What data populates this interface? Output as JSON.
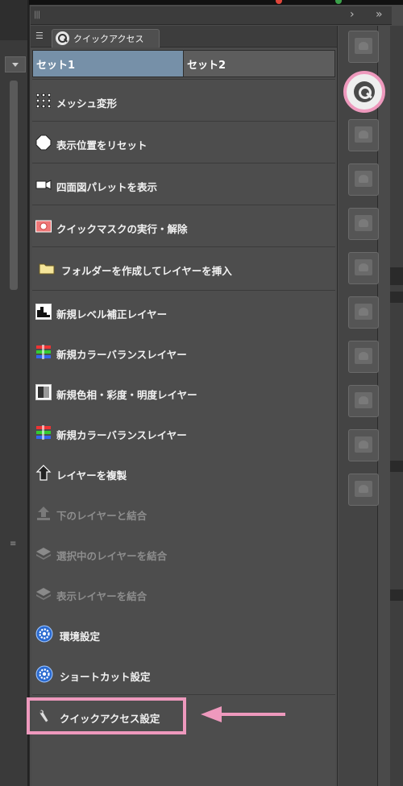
{
  "panel": {
    "tab_label": "クイックアクセス",
    "sets": [
      "セット1",
      "セット2"
    ],
    "active_set": "セット1"
  },
  "items": [
    {
      "label": "メッシュ変形",
      "icon": "mesh-transform-icon",
      "enabled": true
    },
    {
      "label": "表示位置をリセット",
      "icon": "reset-view-icon",
      "enabled": true
    },
    {
      "label": "四面図パレットを表示",
      "icon": "camera-icon",
      "enabled": true
    },
    {
      "label": "クイックマスクの実行・解除",
      "icon": "quick-mask-icon",
      "enabled": true
    },
    {
      "label": "フォルダーを作成してレイヤーを挿入",
      "icon": "folder-icon",
      "enabled": true
    },
    {
      "label": "新規レベル補正レイヤー",
      "icon": "levels-layer-icon",
      "enabled": true
    },
    {
      "label": "新規カラーバランスレイヤー",
      "icon": "color-balance-icon",
      "enabled": true
    },
    {
      "label": "新規色相・彩度・明度レイヤー",
      "icon": "hue-saturation-icon",
      "enabled": true
    },
    {
      "label": "新規カラーバランスレイヤー",
      "icon": "color-balance-icon",
      "enabled": true
    },
    {
      "label": "レイヤーを複製",
      "icon": "duplicate-layer-icon",
      "enabled": true
    },
    {
      "label": "下のレイヤーと結合",
      "icon": "merge-down-icon",
      "enabled": false
    },
    {
      "label": "選択中のレイヤーを結合",
      "icon": "merge-selected-icon",
      "enabled": false
    },
    {
      "label": "表示レイヤーを結合",
      "icon": "merge-visible-icon",
      "enabled": false
    },
    {
      "label": "環境設定",
      "icon": "gear-icon",
      "enabled": true
    },
    {
      "label": "ショートカット設定",
      "icon": "gear-icon",
      "enabled": true
    },
    {
      "label": "クイックアクセス設定",
      "icon": "wrench-icon",
      "enabled": true
    }
  ],
  "colors": {
    "highlight": "#ee99bd",
    "active_set": "#7690a8",
    "panel_bg": "#4b4b4b"
  }
}
